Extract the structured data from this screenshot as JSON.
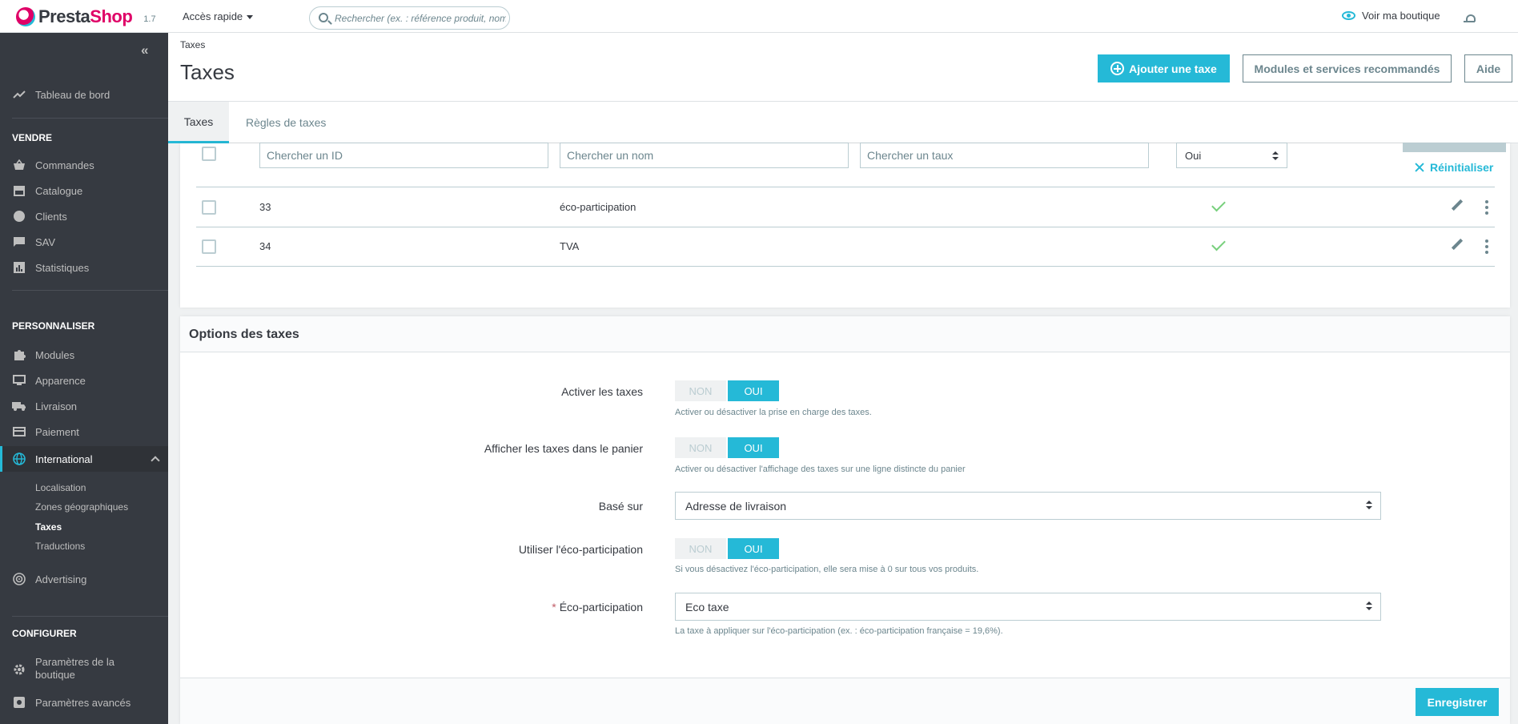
{
  "topbar": {
    "logo_prefix": "Presta",
    "logo_suffix": "Shop",
    "version": "1.7",
    "quick_access": "Accès rapide",
    "search_placeholder": "Rechercher (ex. : référence produit, nom",
    "shop_link": "Voir ma boutique"
  },
  "sidebar": {
    "dashboard": "Tableau de bord",
    "sections": [
      {
        "heading": "VENDRE",
        "items": [
          "Commandes",
          "Catalogue",
          "Clients",
          "SAV",
          "Statistiques"
        ]
      },
      {
        "heading": "PERSONNALISER",
        "items": [
          "Modules",
          "Apparence",
          "Livraison",
          "Paiement",
          "International"
        ]
      },
      {
        "heading": "CONFIGURER",
        "items": [
          "Paramètres de la boutique",
          "Paramètres avancés"
        ]
      }
    ],
    "international_sub": [
      "Localisation",
      "Zones géographiques",
      "Taxes",
      "Traductions"
    ],
    "advertising": "Advertising",
    "active_item": "International",
    "active_sub": "Taxes"
  },
  "header": {
    "breadcrumb": "Taxes",
    "title": "Taxes",
    "add_button": "Ajouter une taxe",
    "modules_button": "Modules et services recommandés",
    "help_button": "Aide"
  },
  "tabs": [
    {
      "label": "Taxes",
      "active": true
    },
    {
      "label": "Règles de taxes",
      "active": false
    }
  ],
  "list": {
    "filters": {
      "id_placeholder": "Chercher un ID",
      "name_placeholder": "Chercher un nom",
      "rate_placeholder": "Chercher un taux",
      "enabled_value": "Oui",
      "reset_label": "Réinitialiser"
    },
    "rows": [
      {
        "id": "33",
        "name": "éco-participation",
        "enabled": true
      },
      {
        "id": "34",
        "name": "TVA",
        "enabled": true
      }
    ]
  },
  "options": {
    "title": "Options des taxes",
    "fields": [
      {
        "label": "Activer les taxes",
        "type": "switch",
        "off": "NON",
        "on": "OUI",
        "value": "OUI",
        "help": "Activer ou désactiver la prise en charge des taxes."
      },
      {
        "label": "Afficher les taxes dans le panier",
        "type": "switch",
        "off": "NON",
        "on": "OUI",
        "value": "OUI",
        "help": "Activer ou désactiver l'affichage des taxes sur une ligne distincte du panier"
      },
      {
        "label": "Basé sur",
        "type": "select",
        "value": "Adresse de livraison"
      },
      {
        "label": "Utiliser l'éco-participation",
        "type": "switch",
        "off": "NON",
        "on": "OUI",
        "value": "OUI",
        "help": "Si vous désactivez l'éco-participation, elle sera mise à 0 sur tous vos produits."
      },
      {
        "label": "Éco-participation",
        "required_mark": "*",
        "type": "select",
        "value": "Eco taxe",
        "help": "La taxe à appliquer sur l'éco-participation (ex. : éco-participation française = 19,6%)."
      }
    ],
    "save_button": "Enregistrer"
  },
  "colors": {
    "accent": "#25b9d7",
    "sidebar_bg": "#363a41",
    "success": "#78d07d",
    "brand_pink": "#df0067"
  }
}
